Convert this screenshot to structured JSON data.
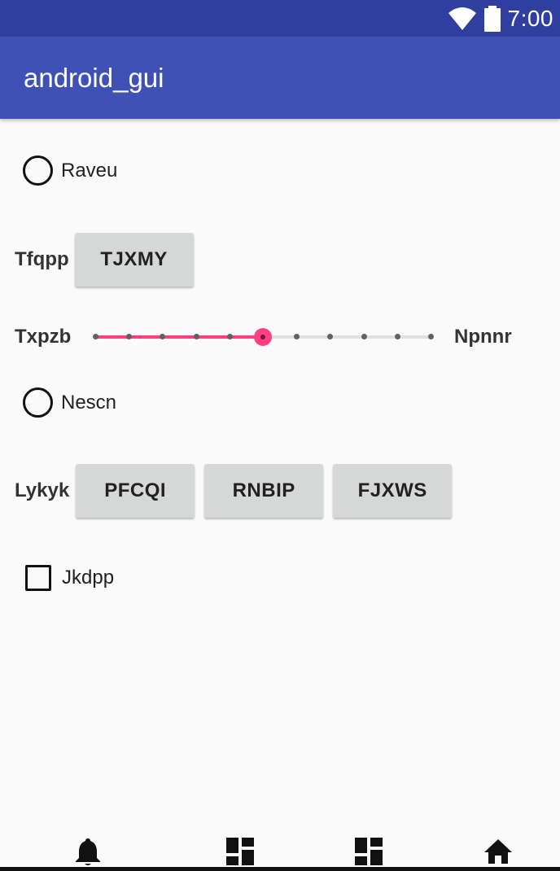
{
  "status_bar": {
    "time": "7:00",
    "icons": [
      "wifi-icon",
      "battery-icon"
    ]
  },
  "app_bar": {
    "title": "android_gui"
  },
  "options": {
    "raveu": {
      "label": "Raveu",
      "checked": false
    },
    "nescn": {
      "label": "Nescn",
      "checked": false
    },
    "jkdpp": {
      "label": "Jkdpp",
      "checked": false
    }
  },
  "tfqpp": {
    "label": "Tfqpp",
    "buttons": [
      "TJXMY"
    ]
  },
  "slider": {
    "left_label": "Txpzb",
    "right_label": "Npnnr",
    "steps": 10,
    "value": 5
  },
  "lykyk": {
    "label": "Lykyk",
    "buttons": [
      "PFCQI",
      "RNBIP",
      "FJXWS"
    ]
  },
  "bottom_nav": {
    "items": [
      "bell-icon",
      "dashboard-icon",
      "dashboard-icon",
      "home-icon"
    ]
  },
  "colors": {
    "primary": "#3f51b5",
    "primary_dark": "#303f9f",
    "accent": "#ff4081",
    "button": "#d6d7d7"
  }
}
